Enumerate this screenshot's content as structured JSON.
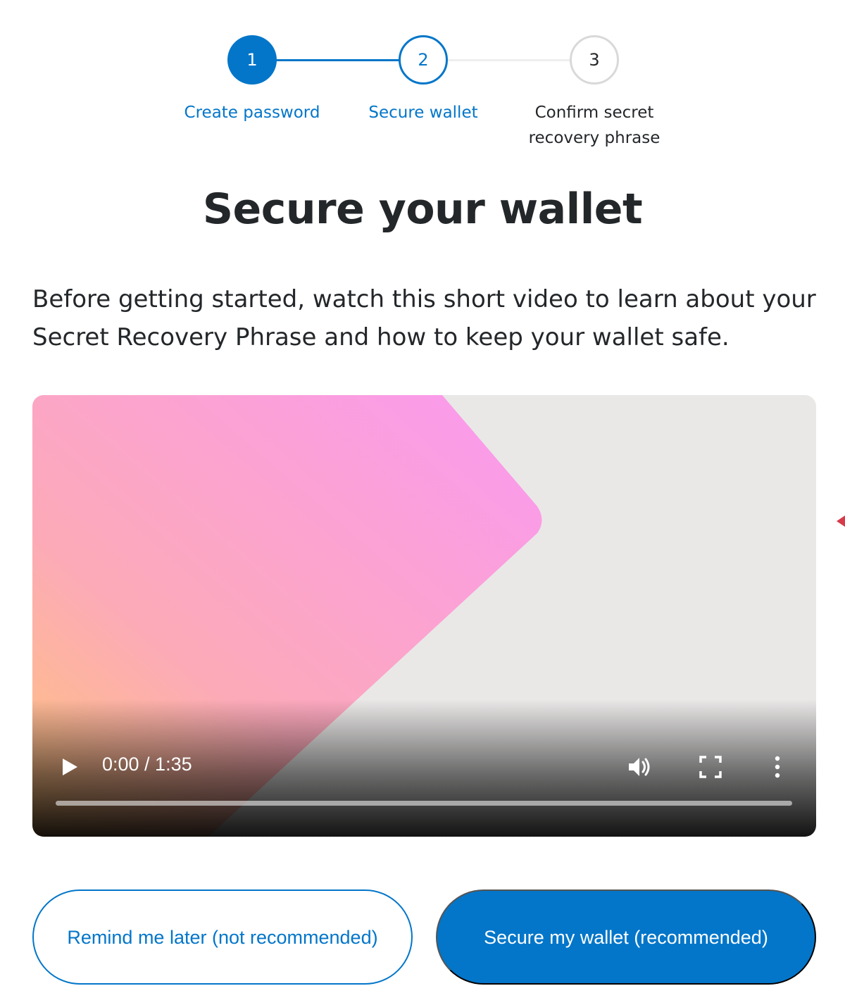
{
  "stepper": {
    "steps": [
      {
        "number": "1",
        "label": "Create password",
        "state": "complete"
      },
      {
        "number": "2",
        "label": "Secure wallet",
        "state": "active"
      },
      {
        "number": "3",
        "label": "Confirm secret recovery phrase",
        "state": "upcoming"
      }
    ]
  },
  "page": {
    "title": "Secure your wallet",
    "intro": "Before getting started, watch this short video to learn about your Secret Recovery Phrase and how to keep your wallet safe."
  },
  "video": {
    "time_display": "0:00 / 1:35"
  },
  "actions": {
    "remind_later_label": "Remind me later (not recommended)",
    "secure_wallet_label": "Secure my wallet (recommended)"
  },
  "colors": {
    "accent": "#0376c9",
    "text": "#24272a",
    "inactive_step": "#d9d9d9"
  }
}
